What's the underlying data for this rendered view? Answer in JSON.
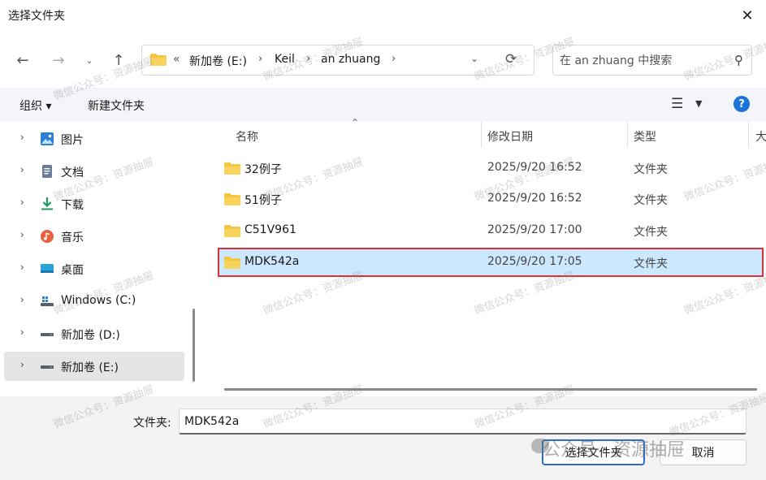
{
  "window": {
    "title": "选择文件夹"
  },
  "address": {
    "overflow": "«",
    "crumbs": [
      "新加卷 (E:)",
      "Keil",
      "an zhuang"
    ]
  },
  "search": {
    "placeholder": "在 an zhuang 中搜索"
  },
  "toolbar": {
    "organize_label": "组织 ▾",
    "new_folder_label": "新建文件夹"
  },
  "sidebar": {
    "items": [
      {
        "label": "图片",
        "icon": "pictures-icon"
      },
      {
        "label": "文档",
        "icon": "documents-icon"
      },
      {
        "label": "下载",
        "icon": "downloads-icon"
      },
      {
        "label": "音乐",
        "icon": "music-icon"
      },
      {
        "label": "桌面",
        "icon": "desktop-icon"
      },
      {
        "label": "Windows (C:)",
        "icon": "windows-drive-icon"
      },
      {
        "label": "新加卷 (D:)",
        "icon": "drive-icon"
      },
      {
        "label": "新加卷 (E:)",
        "icon": "drive-icon",
        "selected": true
      }
    ]
  },
  "columns": {
    "name": "名称",
    "date": "修改日期",
    "type": "类型",
    "size": "大"
  },
  "files": [
    {
      "name": "32例子",
      "date": "2025/9/20 16:52",
      "type": "文件夹"
    },
    {
      "name": "51例子",
      "date": "2025/9/20 16:52",
      "type": "文件夹"
    },
    {
      "name": "C51V961",
      "date": "2025/9/20 17:00",
      "type": "文件夹"
    },
    {
      "name": "MDK542a",
      "date": "2025/9/20 17:05",
      "type": "文件夹",
      "selected": true
    }
  ],
  "footer": {
    "folder_label": "文件夹:",
    "folder_value": "MDK542a",
    "select_label": "选择文件夹",
    "cancel_label": "取消"
  },
  "watermark": {
    "text": "微信公众号：资源抽屉",
    "big_text": "公众号 · 资源抽屉"
  },
  "colors": {
    "accent": "#2b6cd1",
    "selection": "#cce8ff",
    "highlight_border": "#d9323c",
    "folder": "#f4c542"
  }
}
